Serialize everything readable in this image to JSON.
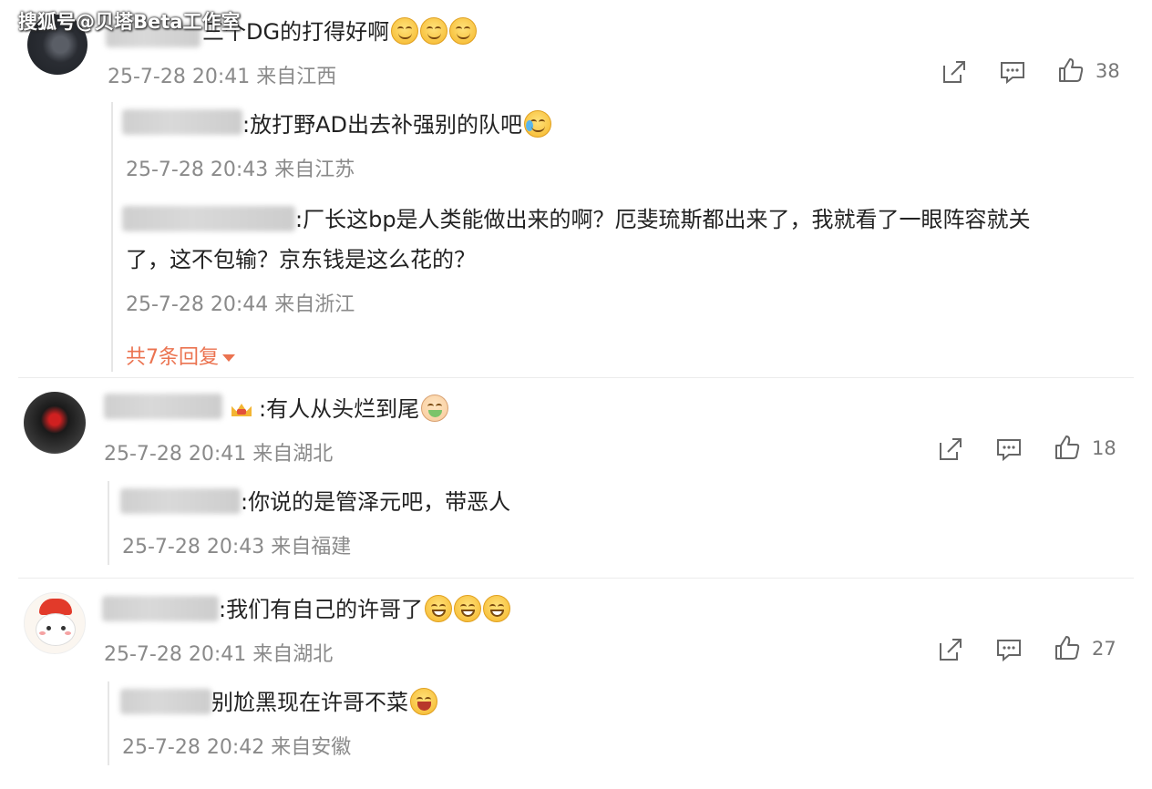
{
  "watermark": "搜狐号@贝塔Beta工作室",
  "comments": [
    {
      "text": "三个DG的打得好啊",
      "meta": "25-7-28 20:41 来自江西",
      "likes": "38",
      "icons": {
        "share": "share-icon",
        "comment": "comment-icon",
        "like": "thumbs-up-icon"
      },
      "replies": [
        {
          "text": ":放打野AD出去补强别的队吧",
          "meta": "25-7-28 20:43 来自江苏"
        },
        {
          "text_line1": ":厂长这bp是人类能做出来的啊？厄斐琉斯都出来了，我就看了一眼阵容就关",
          "text_line2": "了，这不包输？京东钱是这么花的？",
          "meta": "25-7-28 20:44 来自浙江"
        }
      ],
      "more_replies": "共7条回复"
    },
    {
      "text": ":有人从头烂到尾",
      "meta": "25-7-28 20:41 来自湖北",
      "likes": "18",
      "replies": [
        {
          "text": ":你说的是管泽元吧，带恶人",
          "meta": "25-7-28 20:43 来自福建"
        }
      ]
    },
    {
      "text": ":我们有自己的许哥了",
      "meta": "25-7-28 20:41 来自湖北",
      "likes": "27",
      "replies": [
        {
          "text": "别尬黑现在许哥不菜",
          "meta": "25-7-28 20:42 来自安徽"
        }
      ]
    }
  ],
  "colors": {
    "accent": "#eb7350",
    "meta_gray": "#8a8a8a",
    "text": "#222222"
  }
}
